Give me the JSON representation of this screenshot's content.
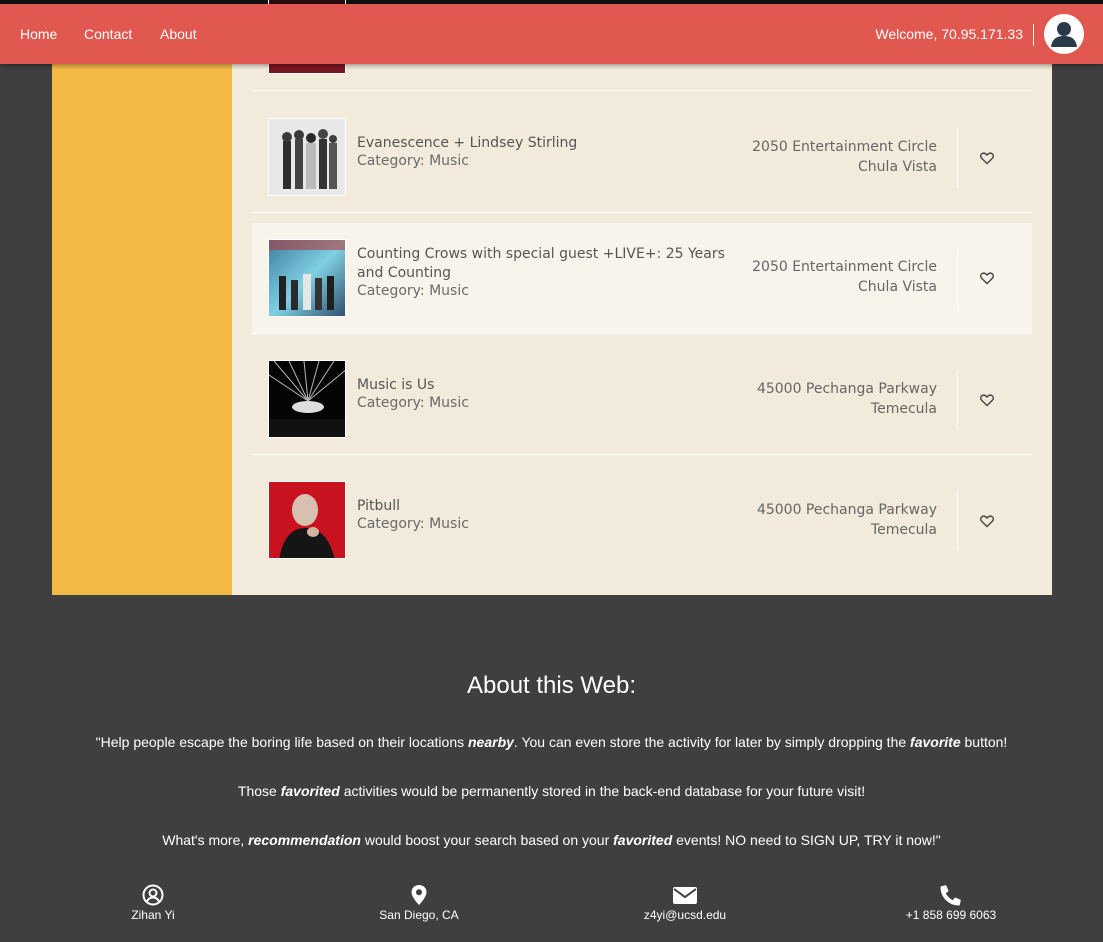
{
  "nav": {
    "home": "Home",
    "contact": "Contact",
    "about": "About"
  },
  "header": {
    "welcome": "Welcome, 70.95.171.33"
  },
  "events": [
    {
      "name": "Evanescence + Lindsey Stirling",
      "category": "Category: Music",
      "address": "2050 Entertainment Circle",
      "city": "Chula Vista"
    },
    {
      "name": "Counting Crows with special guest +LIVE+: 25 Years and Counting",
      "category": "Category: Music",
      "address": "2050 Entertainment Circle",
      "city": "Chula Vista"
    },
    {
      "name": "Music is Us",
      "category": "Category: Music",
      "address": "45000 Pechanga Parkway",
      "city": "Temecula"
    },
    {
      "name": "Pitbull",
      "category": "Category: Music",
      "address": "45000 Pechanga Parkway",
      "city": "Temecula"
    }
  ],
  "footer": {
    "title": "About this Web:",
    "line1": {
      "a": "\"Help people escape the boring life based on their locations ",
      "b": "nearby",
      "c": ". You can even store the activity for later by simply dropping the ",
      "d": "favorite",
      "e": " button!"
    },
    "line2": {
      "a": "Those ",
      "b": "favorited",
      "c": " activities would be permanently stored in the back-end database for your future visit!"
    },
    "line3": {
      "a": "What's more, ",
      "b": "recommendation",
      "c": " would boost your search based on your ",
      "d": "favorited",
      "e": " events! NO need to SIGN UP, TRY it now!\""
    },
    "contacts": {
      "name": "Zihan Yi",
      "location": "San Diego, CA",
      "email": "z4yi@ucsd.edu",
      "phone": "+1 858 699 6063"
    }
  },
  "colors": {
    "header": "#e0584f",
    "sidebar": "#f2b944",
    "content": "#f2ebdb",
    "background": "#3f3f3f"
  },
  "icons": [
    "user-avatar-icon",
    "heart-icon",
    "user-circle-icon",
    "map-pin-icon",
    "envelope-icon",
    "phone-icon"
  ]
}
